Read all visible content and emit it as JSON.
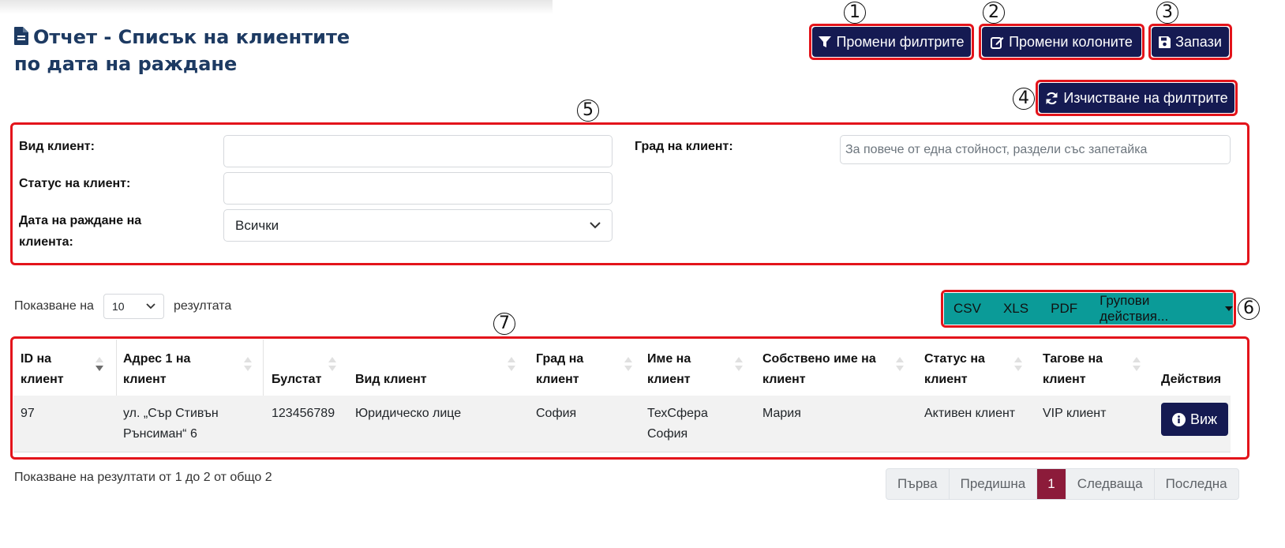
{
  "title": {
    "line1": "Отчет - Списък на клиентите",
    "line2": "по дата на раждане",
    "icon": "file-text-icon"
  },
  "toolbar": {
    "change_filters": "Промени филтрите",
    "change_columns": "Промени колоните",
    "save": "Запази",
    "clear_filters": "Изчистване на филтрите"
  },
  "markers": [
    "1",
    "2",
    "3",
    "4",
    "5",
    "6",
    "7"
  ],
  "filters": {
    "client_type_label": "Вид клиент:",
    "client_type_value": "",
    "client_status_label": "Статус на клиент:",
    "client_status_value": "",
    "birth_date_label_line1": "Дата на раждане на",
    "birth_date_label_line2": "клиента:",
    "birth_date_value": "Всички",
    "client_city_label": "Град на клиент:",
    "client_city_placeholder": "За повече от една стойност, раздели със запетайка"
  },
  "paging": {
    "show_prefix": "Показване на",
    "per_page": "10",
    "show_suffix": "резултата",
    "summary": "Показване на резултати от 1 до 2 от общо 2",
    "buttons": [
      "Първа",
      "Предишна",
      "1",
      "Следваща",
      "Последна"
    ],
    "active_page": "1"
  },
  "export": {
    "csv": "CSV",
    "xls": "XLS",
    "pdf": "PDF",
    "group_actions": "Групови действия..."
  },
  "table": {
    "headers": [
      [
        "ID на",
        "клиент"
      ],
      [
        "Адрес 1 на",
        "клиент"
      ],
      [
        "Булстат"
      ],
      [
        "Вид клиент"
      ],
      [
        "Град на",
        "клиент"
      ],
      [
        "Име на",
        "клиент"
      ],
      [
        "Собствено име на",
        "клиент"
      ],
      [
        "Статус на",
        "клиент"
      ],
      [
        "Тагове на",
        "клиент"
      ],
      [
        "Действия"
      ]
    ],
    "rows": [
      {
        "id": "97",
        "address_line1": "ул. „Сър Стивън",
        "address_line2": "Рънсиман“ 6",
        "bulstat": "123456789",
        "type": "Юридическо лице",
        "city": "София",
        "name_line1": "ТехСфера",
        "name_line2": "София",
        "first_name": "Мария",
        "status": "Активен клиент",
        "tags": "VIP клиент",
        "action": "Виж"
      }
    ]
  },
  "colors": {
    "navy_button": "#151a52",
    "title": "#1d3a62",
    "callout_red": "#e3141b",
    "export_teal": "#0b9b98",
    "active_page": "#8c1b3a"
  }
}
